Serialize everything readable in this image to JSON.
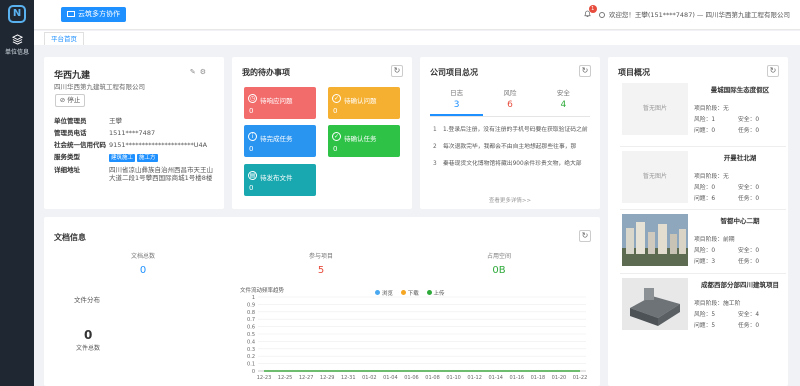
{
  "sidebar": {
    "logo": "N",
    "items": [
      {
        "label": "单位信息",
        "icon": "layers-icon"
      }
    ]
  },
  "header": {
    "collab_button": "云筑多方协作",
    "notification_count": "1",
    "welcome": "欢迎您！王攀(151****7487) — 四川华西第九建工程有限公司"
  },
  "tabs": [
    {
      "label": "平台首页"
    }
  ],
  "company": {
    "name": "华西九建",
    "full_name": "四川华西第九建筑工程有限公司",
    "stop_button": "停止",
    "fields": [
      {
        "key": "单位管理员",
        "value": "王攀"
      },
      {
        "key": "管理员电话",
        "value": "1511****7487"
      },
      {
        "key": "社会统一信用代码",
        "value": "9151*********************U4A"
      },
      {
        "key": "服务类型",
        "tags": [
          "建筑施工",
          "施工方"
        ]
      },
      {
        "key": "详细地址",
        "value": "四川省凉山彝族自治州西昌市天王山大道二段1号攀西国际商城1号楼8楼"
      }
    ]
  },
  "todo": {
    "title": "我的待办事项",
    "items": [
      {
        "label": "待响应问题",
        "value": "0",
        "color": "#f36c6c"
      },
      {
        "label": "待确认问题",
        "value": "0",
        "color": "#f5b031"
      },
      {
        "label": "待完成任务",
        "value": "0",
        "color": "#2a95f0"
      },
      {
        "label": "待确认任务",
        "value": "0",
        "color": "#2ec247"
      },
      {
        "label": "待发布文件",
        "value": "0",
        "color": "#1aa8b0"
      }
    ]
  },
  "overview": {
    "title": "公司项目总况",
    "tabs": [
      {
        "label": "日志",
        "value": "3",
        "color": "#1e90ff"
      },
      {
        "label": "风险",
        "value": "6",
        "color": "#e74c3c"
      },
      {
        "label": "安全",
        "value": "4",
        "color": "#2eaa3a"
      }
    ],
    "news": [
      {
        "index": "1",
        "text": "1.登录后注册，没有注册的手机号码要在获取验证码之前"
      },
      {
        "index": "2",
        "text": "每次退款完毕，我都会不由自主地想起那些往事，那"
      },
      {
        "index": "3",
        "text": "秦巷现货文化博物馆将藏出900余件珍贵文物，绝大部"
      }
    ],
    "more": "查看更多详情>>"
  },
  "projects": {
    "title": "项目概况",
    "no_image": "暂无图片",
    "items": [
      {
        "name": "曼城国际生态度假区",
        "stage": "项目阶段：无",
        "risk": "风险：1",
        "safety": "安全：0",
        "problem": "问题：0",
        "task": "任务：0",
        "has_image": false
      },
      {
        "name": "开曼社北湖",
        "stage": "项目阶段：无",
        "risk": "风险：0",
        "safety": "安全：0",
        "problem": "问题：6",
        "task": "任务：0",
        "has_image": false
      },
      {
        "name": "智都中心二期",
        "stage": "项目阶段：前期",
        "risk": "风险：0",
        "safety": "安全：0",
        "problem": "问题：3",
        "task": "任务：0",
        "has_image": true
      },
      {
        "name": "成都西部分部四川建筑项目",
        "stage": "项目阶段：施工阶",
        "risk": "风险：5",
        "safety": "安全：4",
        "problem": "问题：5",
        "task": "任务：0",
        "has_image": true
      }
    ]
  },
  "docs": {
    "title": "文档信息",
    "stats": [
      {
        "label": "文档总数",
        "value": "0",
        "color": "#1e90ff"
      },
      {
        "label": "参与项目",
        "value": "5",
        "color": "#e74c3c"
      },
      {
        "label": "占用空间",
        "value": "0B",
        "color": "#2eaa3a"
      }
    ],
    "distribution_label": "文件分布",
    "distribution_total": "0",
    "distribution_sub": "文件总数"
  },
  "chart_data": {
    "type": "line",
    "title": "文件流动频率趋势",
    "x": [
      "12-23",
      "12-25",
      "12-27",
      "12-29",
      "12-31",
      "01-02",
      "01-04",
      "01-06",
      "01-08",
      "01-10",
      "01-12",
      "01-14",
      "01-16",
      "01-18",
      "01-20",
      "01-22"
    ],
    "ylim": [
      0,
      1
    ],
    "yticks": [
      "0",
      "0.1",
      "0.2",
      "0.3",
      "0.4",
      "0.5",
      "0.6",
      "0.7",
      "0.8",
      "0.9",
      "1"
    ],
    "series": [
      {
        "name": "浏览",
        "color": "#4aa8f0",
        "values": [
          0,
          0,
          0,
          0,
          0,
          0,
          0,
          0,
          0,
          0,
          0,
          0,
          0,
          0,
          0,
          0
        ]
      },
      {
        "name": "下载",
        "color": "#f5a623",
        "values": [
          0,
          0,
          0,
          0,
          0,
          0,
          0,
          0,
          0,
          0,
          0,
          0,
          0,
          0,
          0,
          0
        ]
      },
      {
        "name": "上传",
        "color": "#2eaa3a",
        "values": [
          0,
          0,
          0,
          0,
          0,
          0,
          0,
          0,
          0,
          0,
          0,
          0,
          0,
          0,
          0,
          0
        ]
      }
    ],
    "grid": true,
    "legend": "top"
  }
}
